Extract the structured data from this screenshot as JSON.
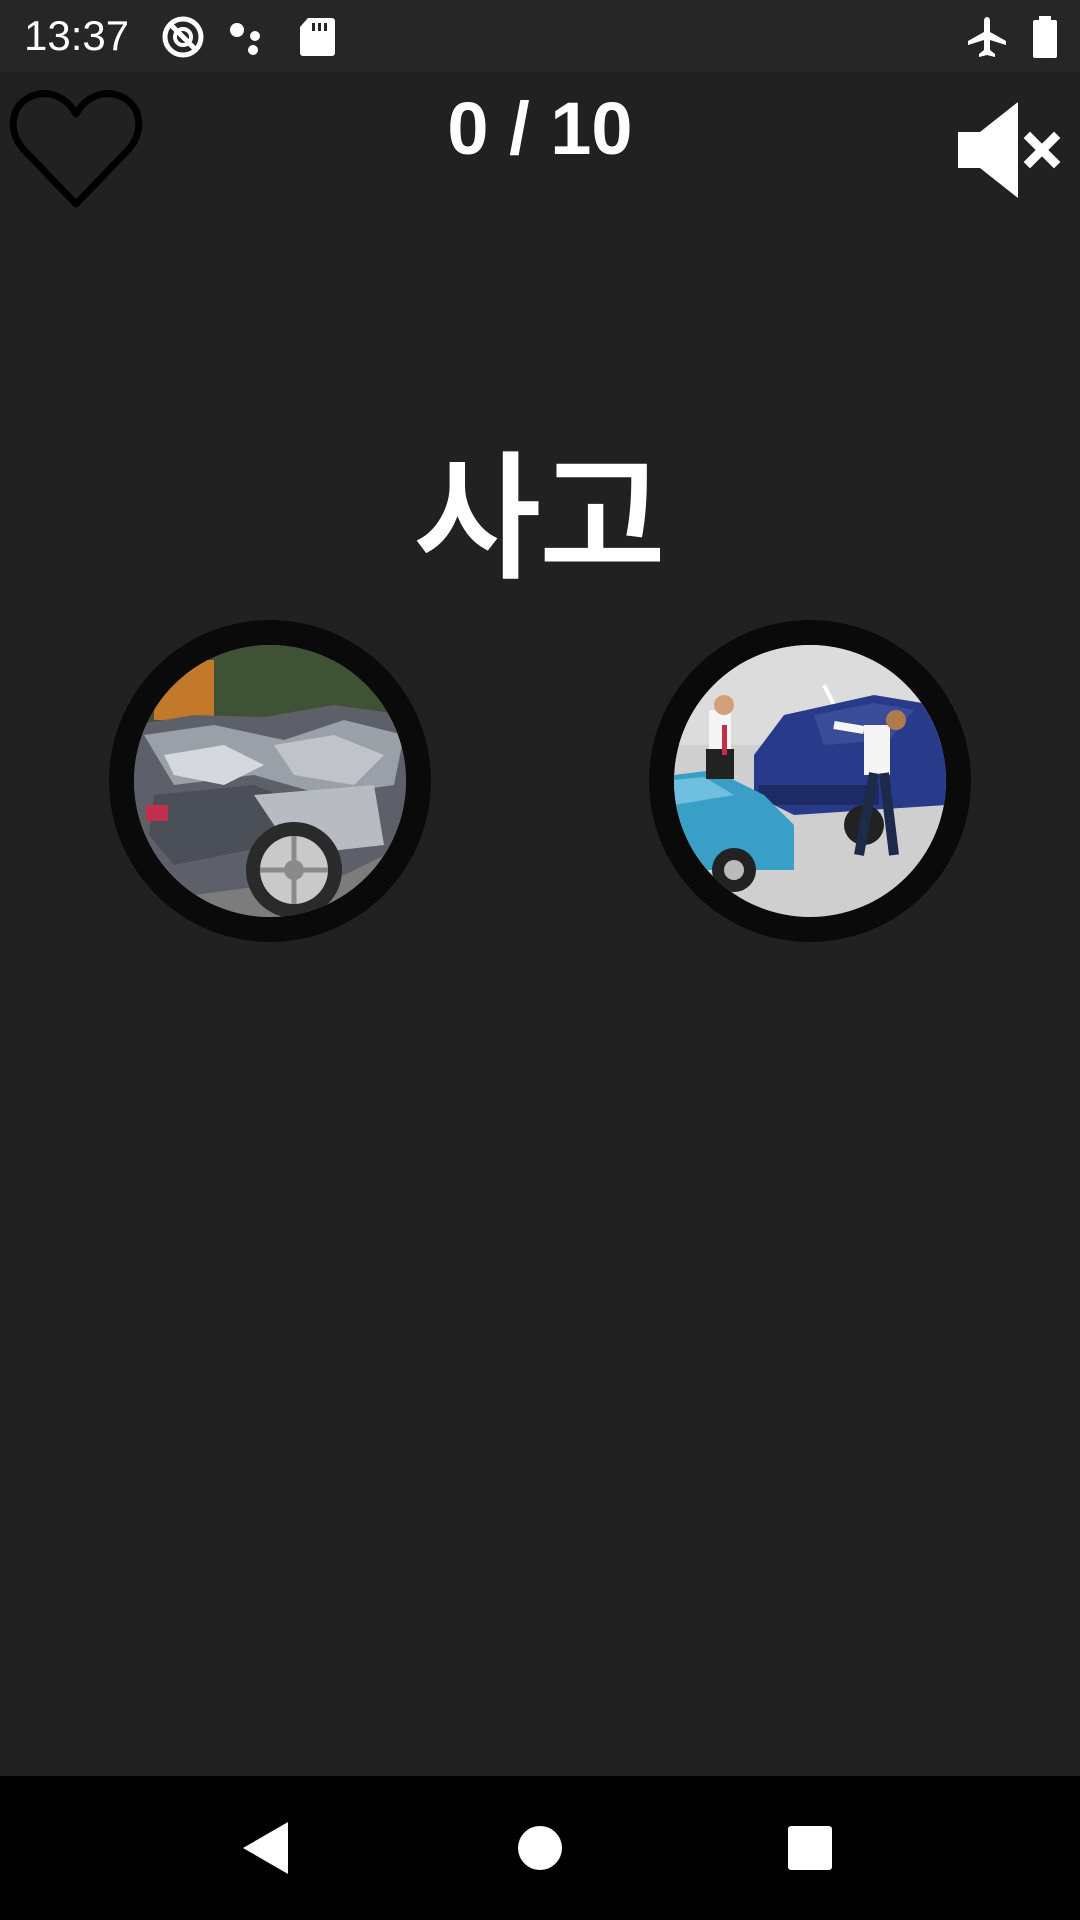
{
  "status_bar": {
    "time": "13:37",
    "icons_left": [
      "do-not-disturb-icon",
      "assistant-dots-icon",
      "sd-card-icon"
    ],
    "icons_right": [
      "airplane-mode-icon",
      "battery-icon"
    ]
  },
  "header": {
    "score": "0 / 10",
    "favorite_icon": "heart-outline-icon",
    "sound_icon": "volume-muted-icon"
  },
  "quiz": {
    "word": "사고",
    "choices": [
      {
        "id": "left",
        "image": "wrecked-car-photo"
      },
      {
        "id": "right",
        "image": "car-collision-argument-photo"
      }
    ]
  },
  "nav_bar": {
    "buttons": [
      "back-icon",
      "home-icon",
      "recents-icon"
    ]
  },
  "colors": {
    "background": "#212121",
    "status_bar": "#262626",
    "nav_bar": "#000000",
    "text": "#ffffff",
    "circle_border": "#0a0a0a"
  }
}
